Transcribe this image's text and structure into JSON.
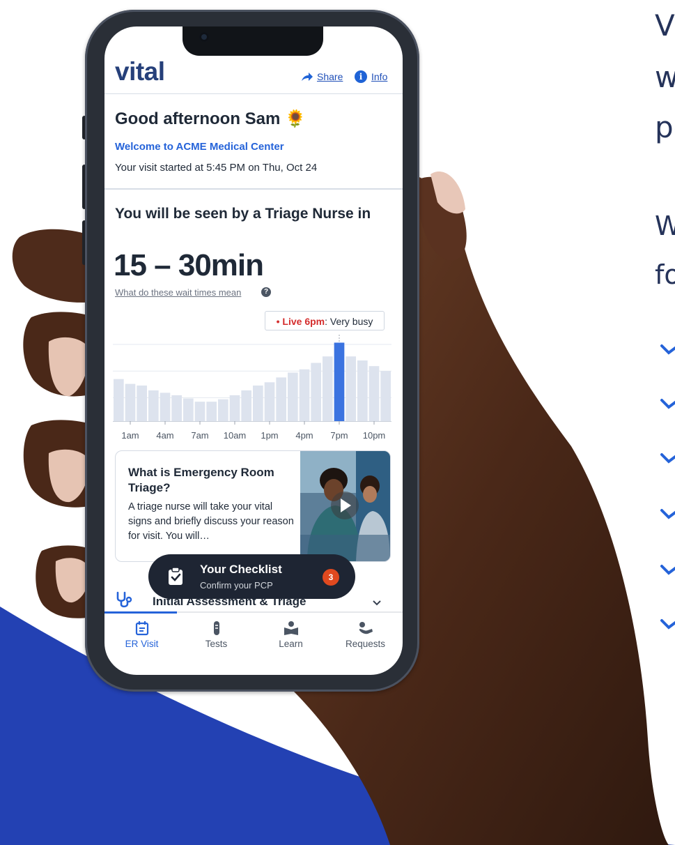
{
  "app": {
    "logo": "vital",
    "share_label": "Share",
    "info_label": "Info"
  },
  "greeting": {
    "title": "Good afternoon Sam 🌻",
    "welcome": "Welcome to ACME Medical Center",
    "visit_started": "Your visit started at 5:45 PM on Thu, Oct 24"
  },
  "wait": {
    "heading": "You will be seen by a Triage Nurse in",
    "range": "15 – 30min",
    "help_link": "What do these wait times mean",
    "live_label": "• Live 6pm",
    "live_status": ": Very busy"
  },
  "chart_data": {
    "type": "bar",
    "title": "",
    "xlabel": "",
    "ylabel": "",
    "categories": [
      "12am",
      "1am",
      "2am",
      "3am",
      "4am",
      "5am",
      "6am",
      "7am",
      "8am",
      "9am",
      "10am",
      "11am",
      "12pm",
      "1pm",
      "2pm",
      "3pm",
      "4pm",
      "5pm",
      "6pm",
      "7pm",
      "8pm",
      "9pm",
      "10pm",
      "11pm"
    ],
    "tick_labels": [
      "1am",
      "4am",
      "7am",
      "10am",
      "1pm",
      "4pm",
      "7pm",
      "10pm"
    ],
    "values": [
      52,
      46,
      44,
      38,
      35,
      32,
      28,
      24,
      24,
      27,
      32,
      38,
      44,
      48,
      54,
      60,
      64,
      72,
      80,
      97,
      80,
      75,
      68,
      62
    ],
    "highlight_category": "6pm",
    "ylim": [
      0,
      100
    ],
    "grid": true,
    "colors": {
      "bar": "#dde3ee",
      "highlight": "#3b73e0"
    }
  },
  "card": {
    "title": "What is Emergency Room Triage?",
    "body": "A triage nurse will take your vital signs and briefly discuss your reason for visit. You will…"
  },
  "checklist": {
    "title": "Your Checklist",
    "subtitle": "Confirm your PCP",
    "count": "3"
  },
  "section": {
    "title": "Initial Assessment & Triage"
  },
  "tabs": [
    {
      "label": "ER Visit",
      "icon": "calendar-icon"
    },
    {
      "label": "Tests",
      "icon": "test-tube-icon"
    },
    {
      "label": "Learn",
      "icon": "book-reader-icon"
    },
    {
      "label": "Requests",
      "icon": "reclining-person-icon"
    }
  ],
  "side_copy": {
    "line1": "Vi",
    "line2": "wi",
    "line3": "pe",
    "line4": "W",
    "line5": "fo"
  },
  "colors": {
    "brand": "#26407a",
    "accent": "#2563d9",
    "badge": "#e0491f",
    "wave": "#2341b3"
  }
}
